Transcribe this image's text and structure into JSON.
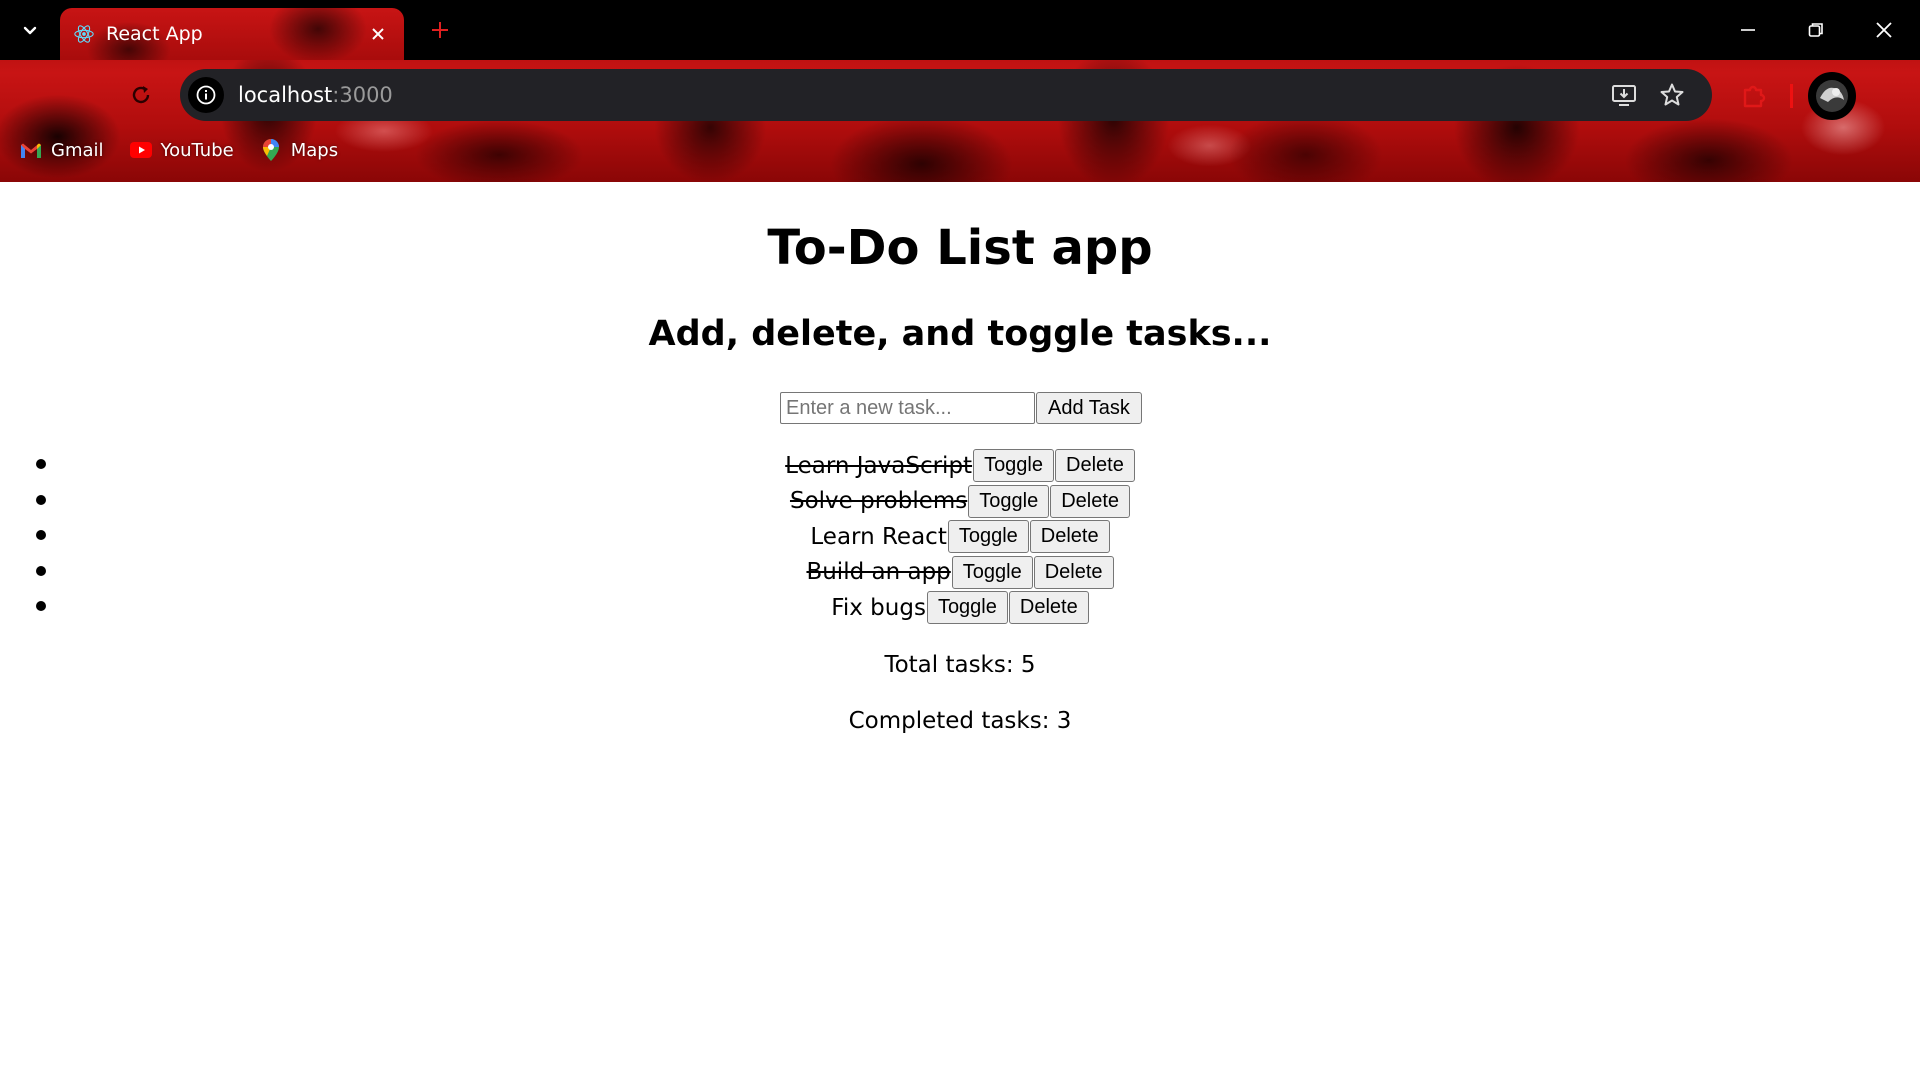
{
  "browser": {
    "tab": {
      "title": "React App",
      "favicon": "react-icon"
    },
    "url": {
      "host": "localhost",
      "port": ":3000"
    },
    "bookmarks": [
      {
        "label": "Gmail",
        "icon": "gmail-icon"
      },
      {
        "label": "YouTube",
        "icon": "youtube-icon"
      },
      {
        "label": "Maps",
        "icon": "maps-icon"
      }
    ],
    "colors": {
      "chrome_bg": "#000000",
      "omnibox_bg": "#222226",
      "theme_red": "#c81414"
    }
  },
  "app": {
    "title": "To-Do List app",
    "subtitle": "Add, delete, and toggle tasks...",
    "input_placeholder": "Enter a new task...",
    "add_label": "Add Task",
    "toggle_label": "Toggle",
    "delete_label": "Delete",
    "tasks": [
      {
        "text": "Learn JavaScript",
        "completed": true
      },
      {
        "text": "Solve problems",
        "completed": true
      },
      {
        "text": "Learn React",
        "completed": false
      },
      {
        "text": "Build an app",
        "completed": true
      },
      {
        "text": "Fix bugs",
        "completed": false
      }
    ],
    "stats": {
      "total": "Total tasks: 5",
      "completed": "Completed tasks: 3"
    }
  }
}
